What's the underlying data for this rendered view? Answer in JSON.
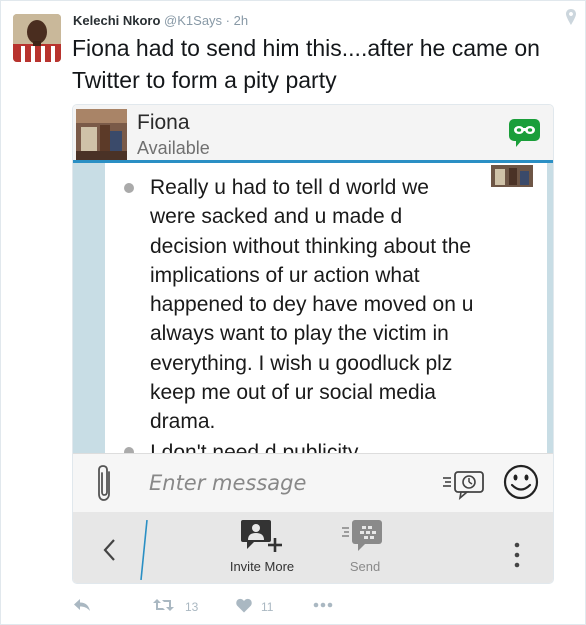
{
  "tweet": {
    "author_name": "Kelechi Nkoro",
    "handle": "@K1Says",
    "separator": "·",
    "time": "2h",
    "text": "Fiona had to send him this....after he came on Twitter to form a pity party",
    "retweet_count": "13",
    "like_count": "11"
  },
  "bbm": {
    "contact_name": "Fiona",
    "contact_status": "Available",
    "messages": [
      "Really u had to tell d world we were sacked and u made d decision without thinking about the implications of ur action what happened to dey have moved on u always want to play the victim in everything. I wish u goodluck plz keep me out of ur social media drama.",
      "I don't need d publicity"
    ],
    "input_placeholder": "Enter message",
    "invite_label": "Invite More",
    "send_label": "Send"
  },
  "colors": {
    "accent_blue": "#2a8fc4",
    "bbm_green": "#1a9e3a",
    "chat_side": "#c8dde5",
    "twitter_gray": "#aab8c2"
  },
  "icons": [
    "pin-icon",
    "bbm-icon",
    "paperclip-icon",
    "voice-note-icon",
    "emoji-icon",
    "back-icon",
    "invite-icon",
    "send-icon",
    "more-icon",
    "reply-icon",
    "retweet-icon",
    "like-icon",
    "more-actions-icon"
  ]
}
